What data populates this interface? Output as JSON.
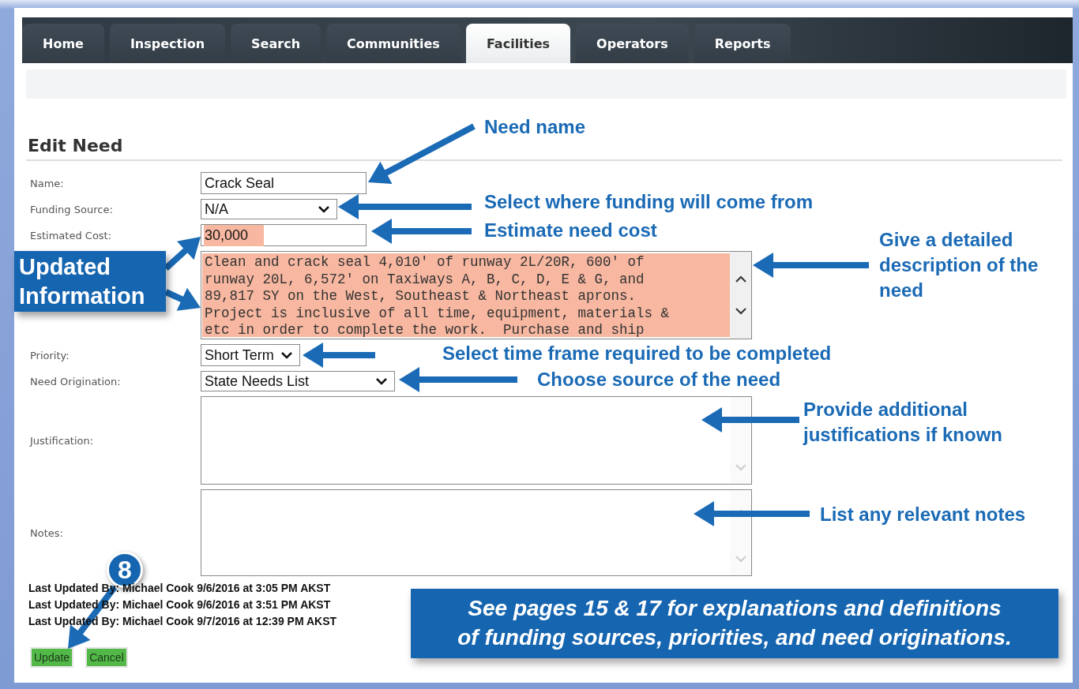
{
  "tabs": [
    {
      "label": "Home",
      "selected": false
    },
    {
      "label": "Inspection",
      "selected": false
    },
    {
      "label": "Search",
      "selected": false
    },
    {
      "label": "Communities",
      "selected": false
    },
    {
      "label": "Facilities",
      "selected": true
    },
    {
      "label": "Operators",
      "selected": false
    },
    {
      "label": "Reports",
      "selected": false
    }
  ],
  "heading": "Edit Need",
  "fields": [
    {
      "kind": "text",
      "label": "Name:",
      "value": "Crack Seal",
      "highlighted": false
    },
    {
      "kind": "select",
      "label": "Funding Source:",
      "value": "N/A",
      "highlighted": false
    },
    {
      "kind": "text",
      "label": "Estimated Cost:",
      "value": "30,000",
      "highlighted": true
    },
    {
      "kind": "textarea",
      "value": "Clean and crack seal 4,010' of runway 2L/20R, 600' of\nrunway 20L, 6,572' on Taxiways A, B, C, D, E & G, and\n89,817 SY on the West, Southeast & Northeast aprons.\nProject is inclusive of all time, equipment, materials &\netc in order to complete the work.  Purchase and ship",
      "highlighted": true
    },
    {
      "kind": "select",
      "label": "Priority:",
      "value": "Short Term",
      "highlighted": false
    },
    {
      "kind": "select",
      "label": "Need Origination:",
      "value": "State Needs List",
      "highlighted": false
    },
    {
      "kind": "textarea",
      "label": "Justification:",
      "highlighted": false
    },
    {
      "kind": "textarea",
      "label": "Notes:",
      "highlighted": false
    }
  ],
  "history": [
    "Last Updated By: Michael Cook 9/6/2016 at 3:05 PM AKST",
    "Last Updated By: Michael Cook 9/6/2016 at 3:51 PM AKST",
    "Last Updated By: Michael Cook 9/7/2016 at 12:39 PM AKST"
  ],
  "buttons": [
    "Update",
    "Cancel"
  ],
  "callouts": [
    "Need name",
    "Select where funding will come from",
    "Estimate need cost",
    "Give a detailed description of the need",
    "Select time frame required to be completed",
    "Choose source of the need",
    "Provide additional justifications if known",
    "List any relevant notes"
  ],
  "updated_label": "Updated Information",
  "step": "8",
  "note": "See pages 15 & 17 for explanations and definitions\nof funding sources, priorities, and need originations."
}
